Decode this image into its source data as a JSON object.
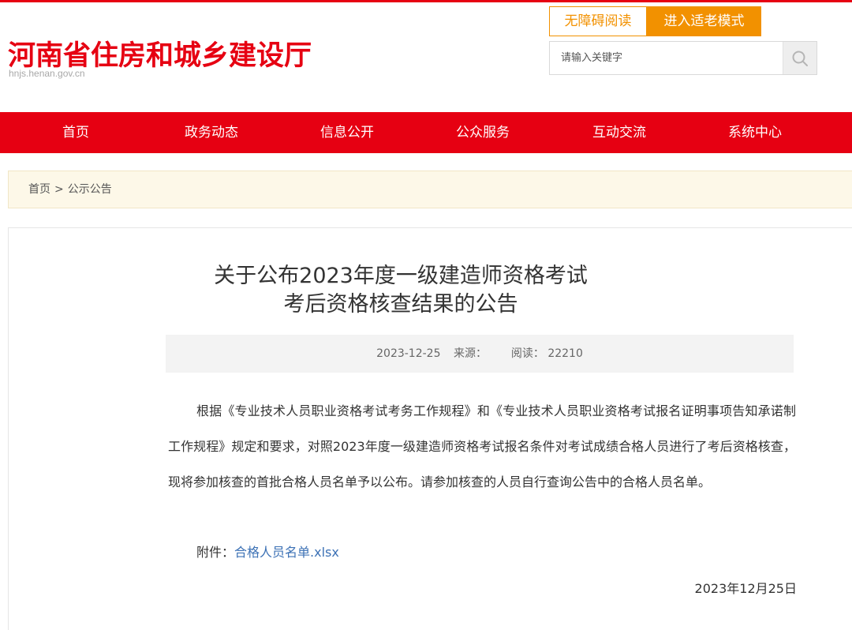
{
  "header": {
    "site_title": "河南省住房和城乡建设厅",
    "site_domain": "hnjs.henan.gov.cn",
    "accessible_button": "无障碍阅读",
    "elder_mode_button": "进入适老模式",
    "search": {
      "placeholder": "请输入关键字",
      "icon": "search-icon"
    }
  },
  "nav": {
    "items": [
      {
        "label": "首页"
      },
      {
        "label": "政务动态"
      },
      {
        "label": "信息公开"
      },
      {
        "label": "公众服务"
      },
      {
        "label": "互动交流"
      },
      {
        "label": "系统中心"
      }
    ]
  },
  "breadcrumb": {
    "home": "首页",
    "separator": ">",
    "current": "公示公告"
  },
  "article": {
    "title_line1": "关于公布2023年度一级建造师资格考试",
    "title_line2": "考后资格核查结果的公告",
    "meta": {
      "date": "2023-12-25",
      "source_label": "来源：",
      "source_value": "",
      "reads_label": "阅读：",
      "reads_value": "22210"
    },
    "body": "根据《专业技术人员职业资格考试考务工作规程》和《专业技术人员职业资格考试报名证明事项告知承诺制工作规程》规定和要求，对照2023年度一级建造师资格考试报名条件对考试成绩合格人员进行了考后资格核查，现将参加核查的首批合格人员名单予以公布。请参加核查的人员自行查询公告中的合格人员名单。",
    "attachment_label": "附件：",
    "attachment_link": "合格人员名单.xlsx",
    "sign_date": "2023年12月25日"
  },
  "colors": {
    "brand_red": "#e60012",
    "accent_orange": "#f29100",
    "link_blue": "#3c71b5",
    "breadcrumb_bg": "#fdf8e8"
  }
}
